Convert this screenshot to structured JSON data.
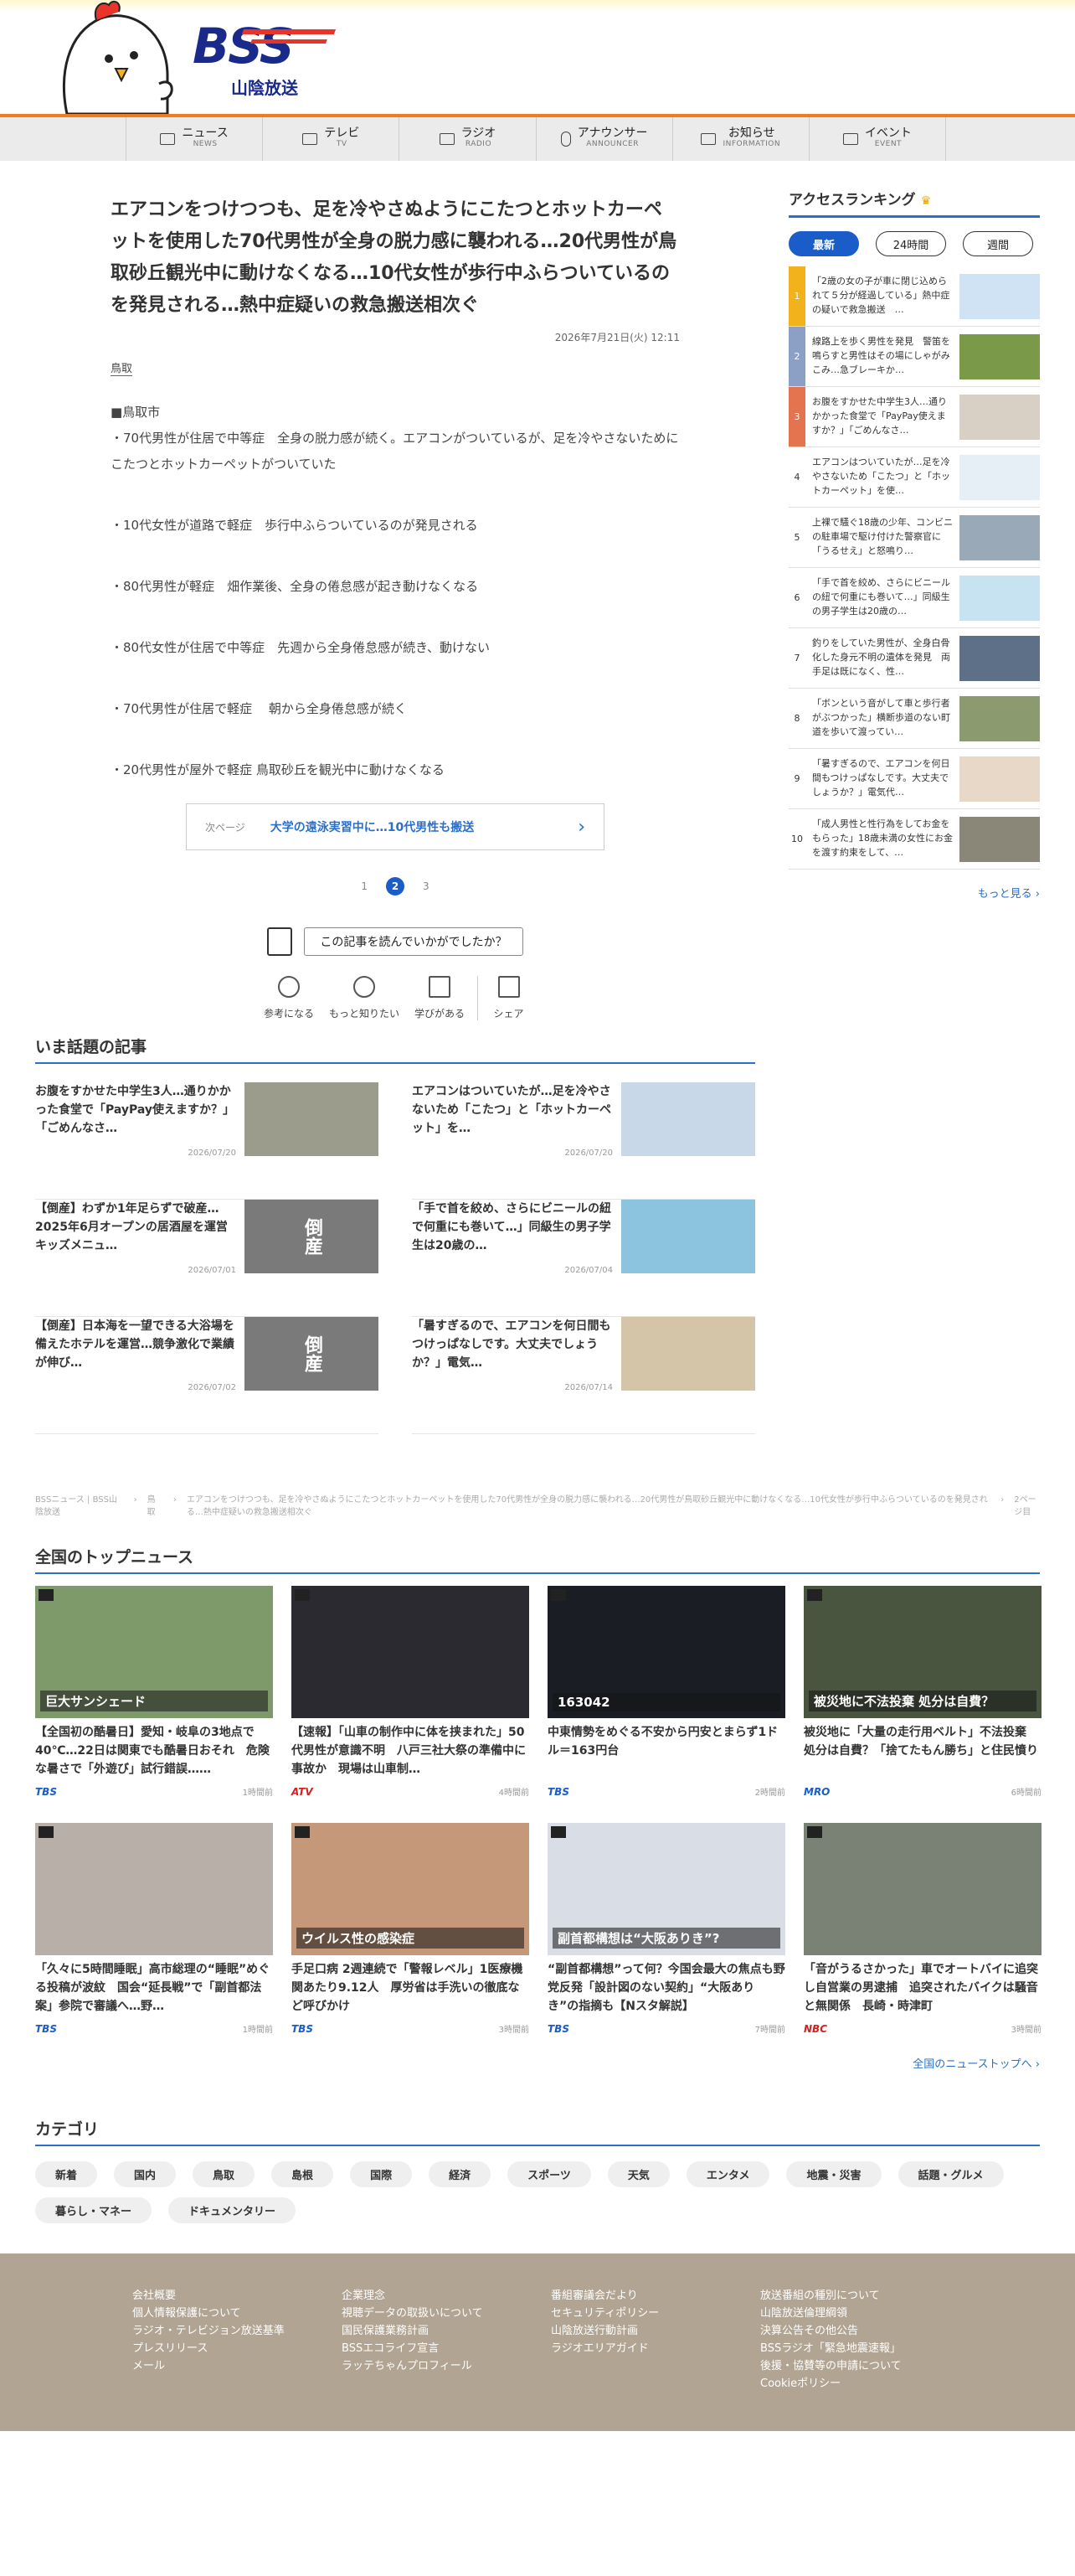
{
  "brand": {
    "logo_text": "BSS",
    "logo_sub": "山陰放送"
  },
  "nav": [
    {
      "jp": "ニュース",
      "en": "NEWS"
    },
    {
      "jp": "テレビ",
      "en": "TV"
    },
    {
      "jp": "ラジオ",
      "en": "RADIO"
    },
    {
      "jp": "アナウンサー",
      "en": "ANNOUNCER"
    },
    {
      "jp": "お知らせ",
      "en": "INFORMATION"
    },
    {
      "jp": "イベント",
      "en": "EVENT"
    }
  ],
  "article": {
    "headline": "エアコンをつけつつも、足を冷やさぬようにこたつとホットカーペットを使用した70代男性が全身の脱力感に襲われる…20代男性が鳥取砂丘観光中に動けなくなる…10代女性が歩行中ふらついているのを発見される…熱中症疑いの救急搬送相次ぐ",
    "date": "2026年7月21日(火) 12:11",
    "category": "鳥取",
    "paragraphs": [
      "■鳥取市\n・70代男性が住居で中等症　全身の脱力感が続く。エアコンがついているが、足を冷やさないためにこたつとホットカーペットがついていた",
      "・10代女性が道路で軽症　歩行中ふらついているのが発見される",
      "・80代男性が軽症　畑作業後、全身の倦怠感が起き動けなくなる",
      "・80代女性が住居で中等症　先週から全身倦怠感が続き、動けない",
      "・70代男性が住居で軽症　 朝から全身倦怠感が続く",
      "・20代男性が屋外で軽症 鳥取砂丘を観光中に動けなくなる"
    ],
    "next_label": "次ページ",
    "next_title": "大学の遠泳実習中に…10代男性も搬送",
    "pages": [
      "1",
      "2",
      "3"
    ],
    "feedback_q": "この記事を読んでいかがでしたか？",
    "reactions": [
      "参考になる",
      "もっと知りたい",
      "学びがある",
      "シェア"
    ]
  },
  "ranking": {
    "title": "アクセスランキング",
    "tabs": [
      "最新",
      "24時間",
      "週間"
    ],
    "items": [
      {
        "n": "1",
        "t": "「2歳の女の子が車に閉じ込められて５分が経過している」熱中症の疑いで救急搬送　…"
      },
      {
        "n": "2",
        "t": "線路上を歩く男性を発見　警笛を鳴らすと男性はその場にしゃがみこみ…急ブレーキか…"
      },
      {
        "n": "3",
        "t": "お腹をすかせた中学生3人…通りかかった食堂で「PayPay使えますか？」「ごめんなさ…"
      },
      {
        "n": "4",
        "t": "エアコンはついていたが…足を冷やさないため「こたつ」と「ホットカーペット」を使…"
      },
      {
        "n": "5",
        "t": "上裸で騒ぐ18歳の少年、コンビニの駐車場で駆け付けた警察官に「うるせえ」と怒鳴り…"
      },
      {
        "n": "6",
        "t": "「手で首を絞め、さらにビニールの紐で何重にも巻いて…」同級生の男子学生は20歳の…"
      },
      {
        "n": "7",
        "t": "釣りをしていた男性が、全身白骨化した身元不明の遺体を発見　両手足は既になく、性…"
      },
      {
        "n": "8",
        "t": "「ボンという音がして車と歩行者がぶつかった」横断歩道のない町道を歩いて渡ってい…"
      },
      {
        "n": "9",
        "t": "「暑すぎるので、エアコンを何日間もつけっぱなしです。大丈夫でしょうか？」電気代…"
      },
      {
        "n": "10",
        "t": "「成人男性と性行為をしてお金をもらった」18歳未満の女性にお金を渡す約束をして、…"
      }
    ],
    "more": "もっと見る"
  },
  "topics": {
    "title": "いま話題の記事",
    "items": [
      {
        "t": "お腹をすかせた中学生3人…通りかかった食堂で「PayPay使えますか？」「ごめんなさ…",
        "d": "2026/07/20"
      },
      {
        "t": "エアコンはついていたが…足を冷やさないため「こたつ」と「ホットカーペット」を…",
        "d": "2026/07/20"
      },
      {
        "t": "【倒産】わずか1年足らずで破産…2025年6月オープンの居酒屋を運営　キッズメニュ…",
        "d": "2026/07/01"
      },
      {
        "t": "「手で首を絞め、さらにビニールの紐で何重にも巻いて…」同級生の男子学生は20歳の…",
        "d": "2026/07/04"
      },
      {
        "t": "【倒産】日本海を一望できる大浴場を備えたホテルを運営…競争激化で業績が伸び…",
        "d": "2026/07/02"
      },
      {
        "t": "「暑すぎるので、エアコンを何日間もつけっぱなしです。大丈夫でしょうか？」電気…",
        "d": "2026/07/14"
      }
    ],
    "bankrupt_label": "倒産"
  },
  "breadcrumb": [
    "BSSニュース | BSS山陰放送",
    "鳥取",
    "エアコンをつけつつも、足を冷やさぬようにこたつとホットカーペットを使用した70代男性が全身の脱力感に襲われる…20代男性が鳥取砂丘観光中に動けなくなる…10代女性が歩行中ふらついているのを発見される…熱中症疑いの救急搬送相次ぐ",
    "2ページ目"
  ],
  "national": {
    "title": "全国のトップニュース",
    "items": [
      {
        "t": "【全国初の酷暑日】愛知・岐阜の3地点で40℃…22日は関東でも酷暑日おそれ　危険な暑さで「外遊び」試行錯誤……",
        "src": "TBS",
        "time": "1時間前",
        "caption": "巨大サンシェード"
      },
      {
        "t": "【速報】「山車の制作中に体を挟まれた」50代男性が意識不明　八戸三社大祭の準備中に事故か　現場は山車制…",
        "src": "ATV",
        "time": "4時間前",
        "caption": ""
      },
      {
        "t": "中東情勢をめぐる不安から円安とまらず1ドル＝163円台",
        "src": "TBS",
        "time": "2時間前",
        "caption": "163042"
      },
      {
        "t": "被災地に「大量の走行用ベルト」不法投棄 処分は自費？「捨てたもん勝ち」と住民憤り",
        "src": "MRO",
        "time": "6時間前",
        "caption": "被災地に不法投棄 処分は自費？"
      },
      {
        "t": "「久々に5時間睡眠」高市総理の“睡眠”めぐる投稿が波紋　国会“延長戦”で「副首都法案」参院で審議へ…野…",
        "src": "TBS",
        "time": "1時間前",
        "caption": ""
      },
      {
        "t": "手足口病 2週連続で「警報レベル」1医療機関あたり9.12人　厚労省は手洗いの徹底など呼びかけ",
        "src": "TBS",
        "time": "3時間前",
        "caption": "ウイルス性の感染症"
      },
      {
        "t": "“副首都構想”って何？今国会最大の焦点も野党反発「設計図のない契約」“大阪ありき”の指摘も【Nスタ解説】",
        "src": "TBS",
        "time": "7時間前",
        "caption": "副首都構想は“大阪ありき”?"
      },
      {
        "t": "「音がうるさかった」車でオートバイに追突し自営業の男逮捕　追突されたバイクは騒音と無関係　長崎・時津町",
        "src": "NBC",
        "time": "3時間前",
        "caption": ""
      }
    ],
    "more": "全国のニューストップへ"
  },
  "categories": {
    "title": "カテゴリ",
    "items": [
      "新着",
      "国内",
      "鳥取",
      "島根",
      "国際",
      "経済",
      "スポーツ",
      "天気",
      "エンタメ",
      "地震・災害",
      "話題・グルメ",
      "暮らし・マネー",
      "ドキュメンタリー"
    ]
  },
  "footer": {
    "cols": [
      [
        "会社概要",
        "個人情報保護について",
        "ラジオ・テレビジョン放送基準",
        "プレスリリース",
        "メール"
      ],
      [
        "企業理念",
        "視聴データの取扱いについて",
        "国民保護業務計画",
        "BSSエコライフ宣言",
        "ラッテちゃんプロフィール"
      ],
      [
        "番組審議会だより",
        "セキュリティポリシー",
        "山陰放送行動計画",
        "ラジオエリアガイド"
      ],
      [
        "放送番組の種別について",
        "山陰放送倫理綱領",
        "決算公告その他公告",
        "BSSラジオ「緊急地震速報」",
        "後援・協賛等の申請について",
        "Cookieポリシー"
      ]
    ]
  },
  "colors": {
    "accent": "#2a6fc9",
    "header_line": "#ef7d20",
    "footer_bg": "#b1a493"
  }
}
